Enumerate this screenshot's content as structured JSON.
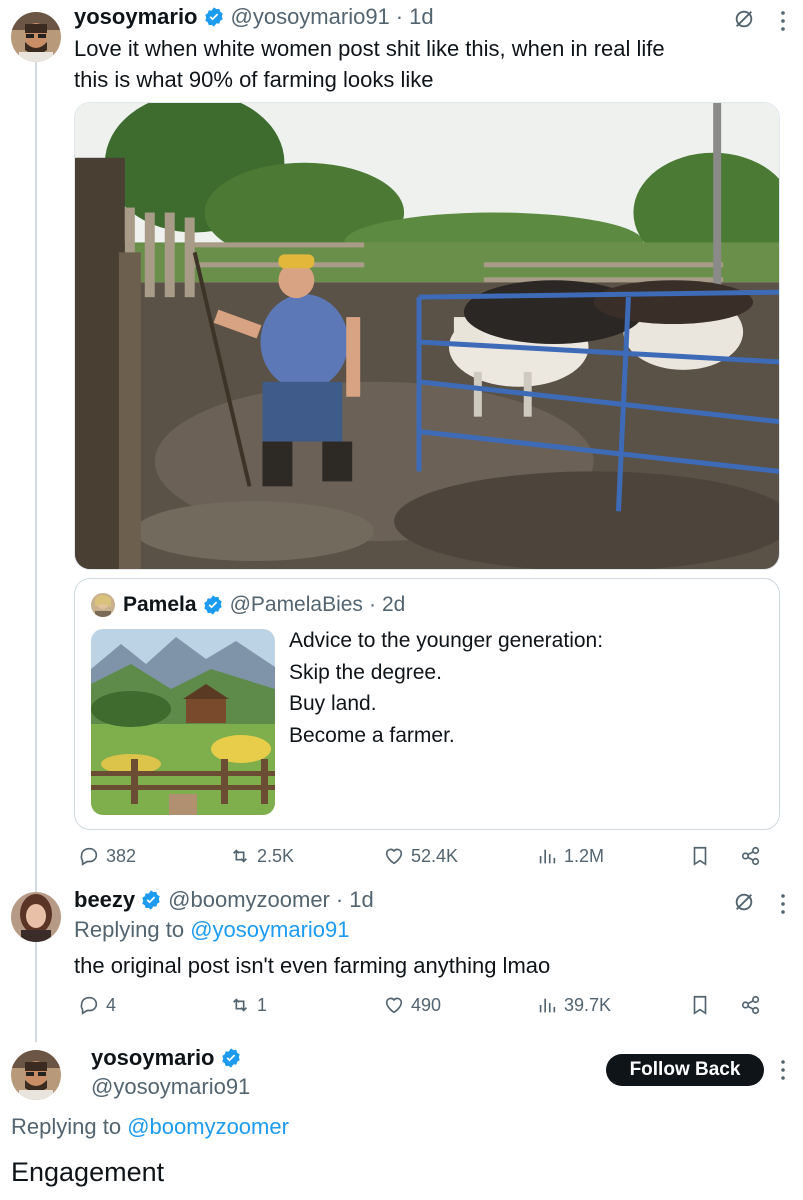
{
  "main_tweet": {
    "name": "yosoymario",
    "handle": "@yosoymario91",
    "time": "1d",
    "text_line1": "Love it when white women post shit like this, when in real life",
    "text_line2": "this is what 90% of farming looks like",
    "stats": {
      "replies": "382",
      "reposts": "2.5K",
      "likes": "52.4K",
      "views": "1.2M"
    }
  },
  "quote_tweet": {
    "name": "Pamela",
    "handle": "@PamelaBies",
    "time": "2d",
    "lines": [
      "Advice to the younger generation:",
      "Skip the degree.",
      "Buy land.",
      "Become a farmer."
    ]
  },
  "reply_tweet": {
    "name": "beezy",
    "handle": "@boomyzoomer",
    "time": "1d",
    "replying_label": "Replying to",
    "replying_to": "@yosoymario91",
    "text": "the original post isn't even farming anything lmao",
    "stats": {
      "replies": "4",
      "reposts": "1",
      "likes": "490",
      "views": "39.7K"
    }
  },
  "focused_tweet": {
    "name": "yosoymario",
    "handle": "@yosoymario91",
    "follow_label": "Follow Back",
    "replying_label": "Replying to",
    "replying_to": "@boomyzoomer",
    "text": "Engagement"
  },
  "colors": {
    "accent": "#1d9bf0",
    "text": "#0f1419",
    "secondary_text": "#536471",
    "verified": "#1d9bf0",
    "button_bg": "#0f1419"
  },
  "icons": [
    "verified-badge-icon",
    "grok-icon",
    "more-icon",
    "reply-icon",
    "repost-icon",
    "like-icon",
    "views-icon",
    "bookmark-icon",
    "share-icon"
  ]
}
